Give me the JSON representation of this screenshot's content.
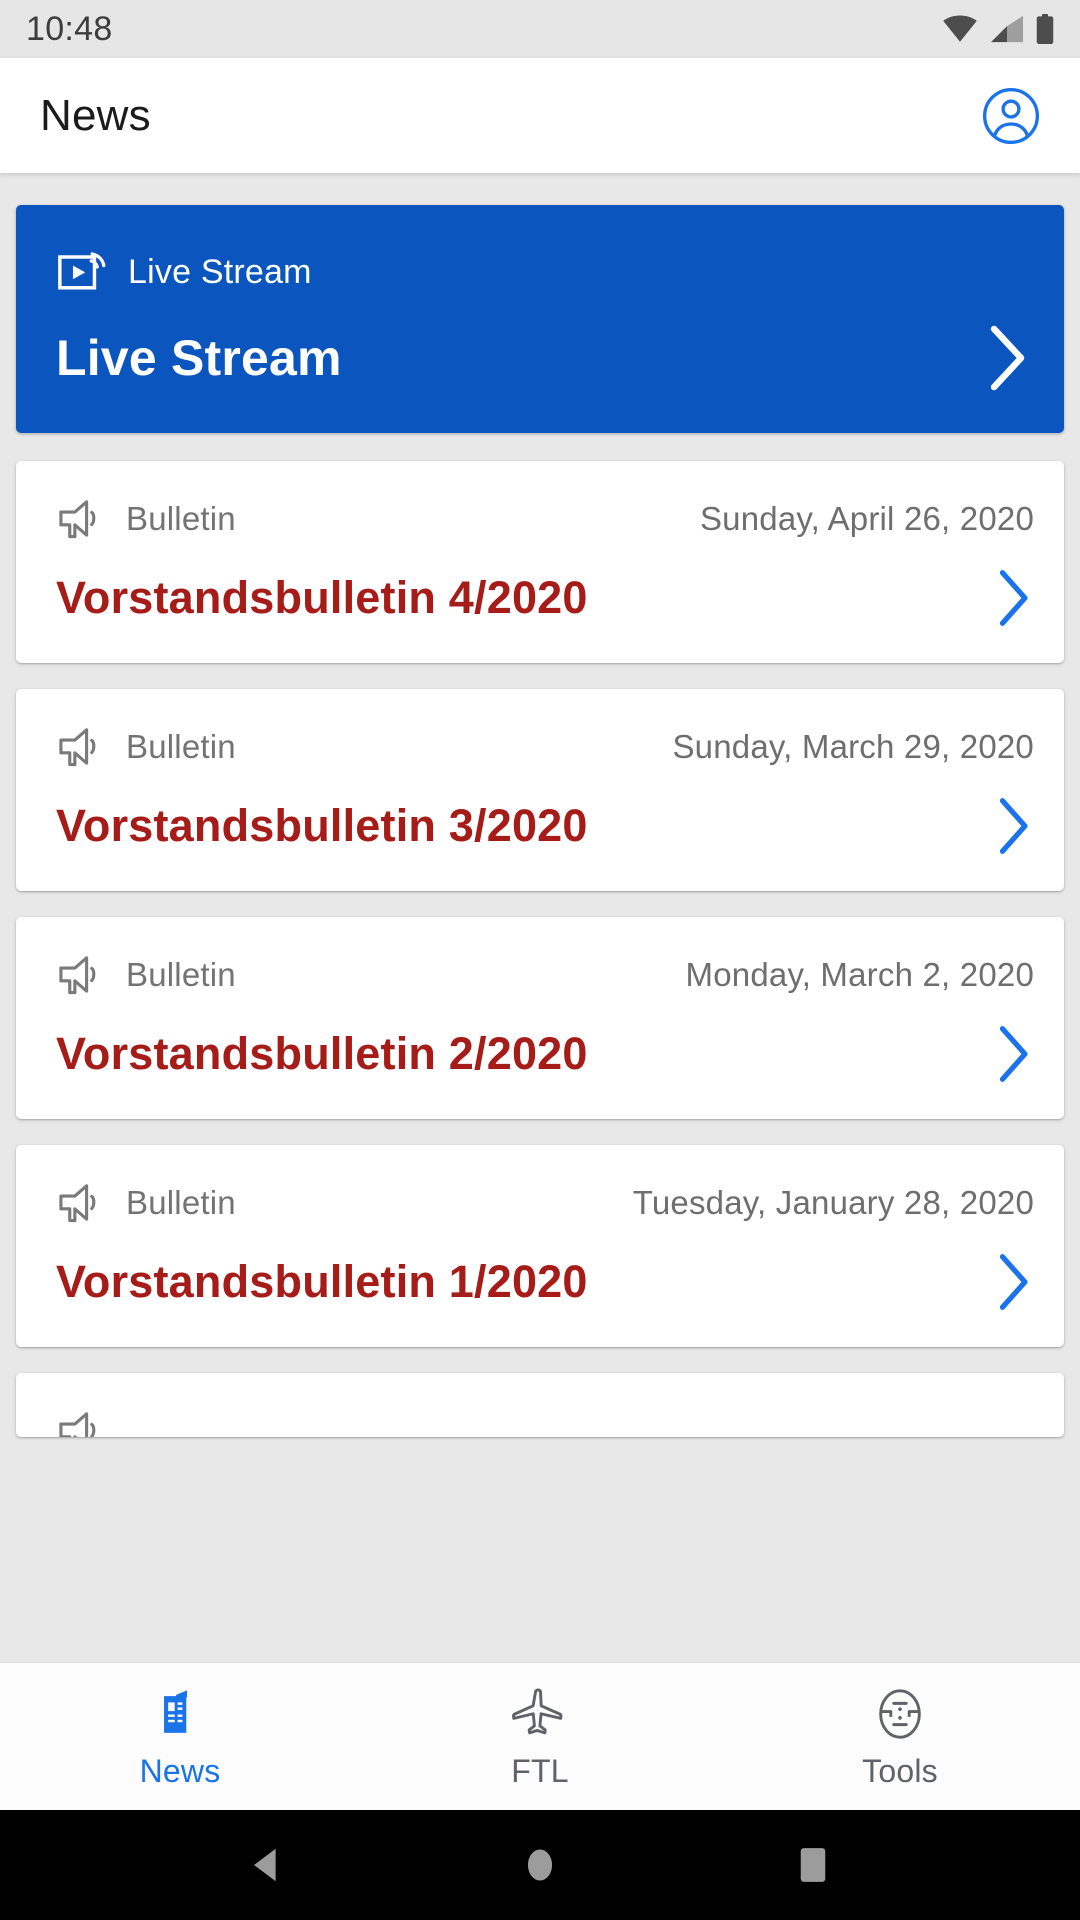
{
  "status_bar": {
    "time": "10:48",
    "icons": [
      "wifi-icon",
      "cellular-signal-icon",
      "battery-icon"
    ]
  },
  "app_bar": {
    "title": "News",
    "account_icon": "account-circle-icon"
  },
  "colors": {
    "brand_blue": "#0b55be",
    "accent_blue": "#1a73e8",
    "bulletin_red": "#a61c18",
    "page_bg": "#e8e8e8",
    "meta_gray": "#737373"
  },
  "live_card": {
    "icon": "cast-stream-icon",
    "category": "Live Stream",
    "title": "Live Stream",
    "chevron": "chevron-right-icon"
  },
  "bulletins": [
    {
      "icon": "megaphone-icon",
      "category": "Bulletin",
      "date": "Sunday, April 26, 2020",
      "title": "Vorstandsbulletin 4/2020",
      "chevron": "chevron-right-icon"
    },
    {
      "icon": "megaphone-icon",
      "category": "Bulletin",
      "date": "Sunday, March 29, 2020",
      "title": "Vorstandsbulletin 3/2020",
      "chevron": "chevron-right-icon"
    },
    {
      "icon": "megaphone-icon",
      "category": "Bulletin",
      "date": "Monday, March 2, 2020",
      "title": "Vorstandsbulletin 2/2020",
      "chevron": "chevron-right-icon"
    },
    {
      "icon": "megaphone-icon",
      "category": "Bulletin",
      "date": "Tuesday, January 28, 2020",
      "title": "Vorstandsbulletin 1/2020",
      "chevron": "chevron-right-icon"
    }
  ],
  "bottom_nav": {
    "items": [
      {
        "label": "News",
        "icon": "newspaper-icon",
        "active": true
      },
      {
        "label": "FTL",
        "icon": "airplane-icon",
        "active": false
      },
      {
        "label": "Tools",
        "icon": "tools-face-icon",
        "active": false
      }
    ]
  },
  "system_nav": {
    "back": "back-triangle-icon",
    "home": "home-circle-icon",
    "recents": "recents-square-icon"
  }
}
